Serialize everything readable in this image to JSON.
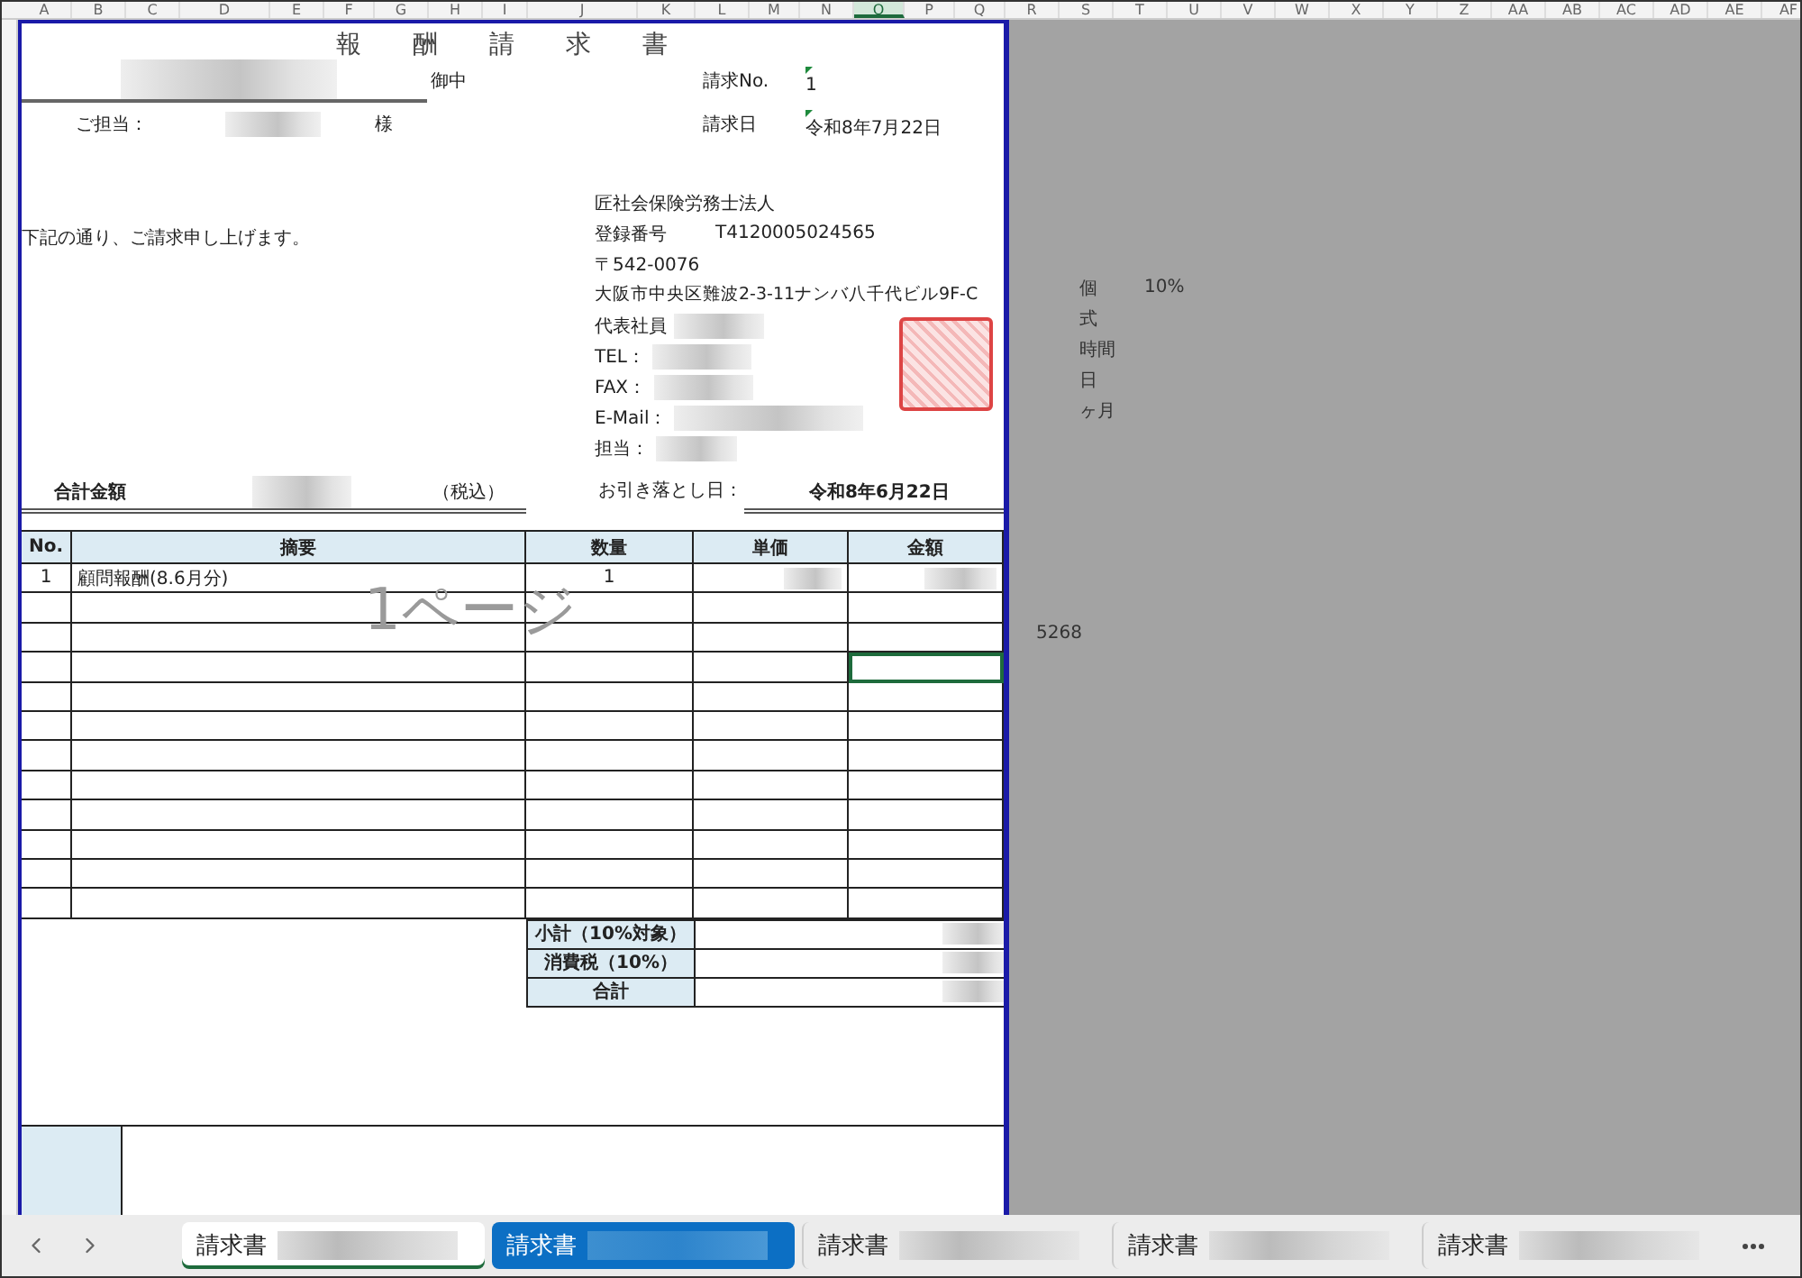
{
  "sheet": {
    "columns": [
      {
        "label": "A",
        "selected": false
      },
      {
        "label": "B",
        "selected": false
      },
      {
        "label": "C",
        "selected": false
      },
      {
        "label": "D",
        "selected": false
      },
      {
        "label": "E",
        "selected": false
      },
      {
        "label": "F",
        "selected": false
      },
      {
        "label": "G",
        "selected": false
      },
      {
        "label": "H",
        "selected": false
      },
      {
        "label": "I",
        "selected": false
      },
      {
        "label": "J",
        "selected": false
      },
      {
        "label": "K",
        "selected": false
      },
      {
        "label": "L",
        "selected": false
      },
      {
        "label": "M",
        "selected": false
      },
      {
        "label": "N",
        "selected": false
      },
      {
        "label": "O",
        "selected": true
      },
      {
        "label": "P",
        "selected": false
      },
      {
        "label": "Q",
        "selected": false
      },
      {
        "label": "R",
        "selected": false
      },
      {
        "label": "S",
        "selected": false
      },
      {
        "label": "T",
        "selected": false
      },
      {
        "label": "U",
        "selected": false
      },
      {
        "label": "V",
        "selected": false
      },
      {
        "label": "W",
        "selected": false
      },
      {
        "label": "X",
        "selected": false
      },
      {
        "label": "Y",
        "selected": false
      },
      {
        "label": "Z",
        "selected": false
      },
      {
        "label": "AA",
        "selected": false
      },
      {
        "label": "AB",
        "selected": false
      },
      {
        "label": "AC",
        "selected": false
      },
      {
        "label": "AD",
        "selected": false
      },
      {
        "label": "AE",
        "selected": false
      },
      {
        "label": "AF",
        "selected": false
      }
    ]
  },
  "invoice": {
    "title": "報 酬 請 求 書",
    "addressee_suffix": "御中",
    "contact_label": "ご担当：",
    "contact_suffix": "様",
    "meta": [
      {
        "label": "請求No.",
        "value": "1"
      },
      {
        "label": "請求日",
        "value": "令和8年7月22日"
      }
    ],
    "company": "匠社会保険労務士法人",
    "intro": "下記の通り、ご請求申し上げます。",
    "registration": {
      "label": "登録番号",
      "value": "T4120005024565"
    },
    "postal": "〒542-0076",
    "address": "大阪市中央区難波2-3-11ナンバ八千代ビル9F-C",
    "contacts": [
      {
        "label": "代表社員"
      },
      {
        "label": "TEL："
      },
      {
        "label": "FAX："
      },
      {
        "label": "E-Mail："
      },
      {
        "label": "担当："
      }
    ],
    "total_label": "合計金額",
    "tax_note": "（税込）",
    "debit_label": "お引き落とし日：",
    "debit_date": "令和8年6月22日",
    "table": {
      "columns": [
        "No.",
        "摘要",
        "数量",
        "単価",
        "金額"
      ],
      "rows": [
        {
          "no": "1",
          "description": "顧問報酬(8.6月分)",
          "quantity": "1",
          "amount_selected": false
        },
        {
          "amount_selected": false
        },
        {
          "amount_selected": false
        },
        {
          "amount_selected": true
        },
        {
          "amount_selected": false
        },
        {
          "amount_selected": false
        },
        {
          "amount_selected": false
        },
        {
          "amount_selected": false
        },
        {
          "amount_selected": false
        },
        {
          "amount_selected": false
        },
        {
          "amount_selected": false
        },
        {
          "amount_selected": false
        }
      ]
    },
    "summary": [
      {
        "label": "小計（10%対象）"
      },
      {
        "label": "消費税（10%）"
      },
      {
        "label": "合計"
      }
    ],
    "watermark": "1ページ"
  },
  "side_notes": {
    "units": [
      {
        "label": "個",
        "note": "10%"
      },
      {
        "label": "式"
      },
      {
        "label": "時間"
      },
      {
        "label": "日"
      },
      {
        "label": "ヶ月"
      }
    ],
    "value": "5268"
  },
  "tabs": [
    {
      "label": "請求書",
      "selected": true,
      "highlighted": false
    },
    {
      "label": "請求書",
      "selected": false,
      "highlighted": true
    },
    {
      "label": "請求書",
      "selected": false,
      "highlighted": false
    },
    {
      "label": "請求書",
      "selected": false,
      "highlighted": false
    },
    {
      "label": "請求書",
      "selected": false,
      "highlighted": false
    }
  ]
}
